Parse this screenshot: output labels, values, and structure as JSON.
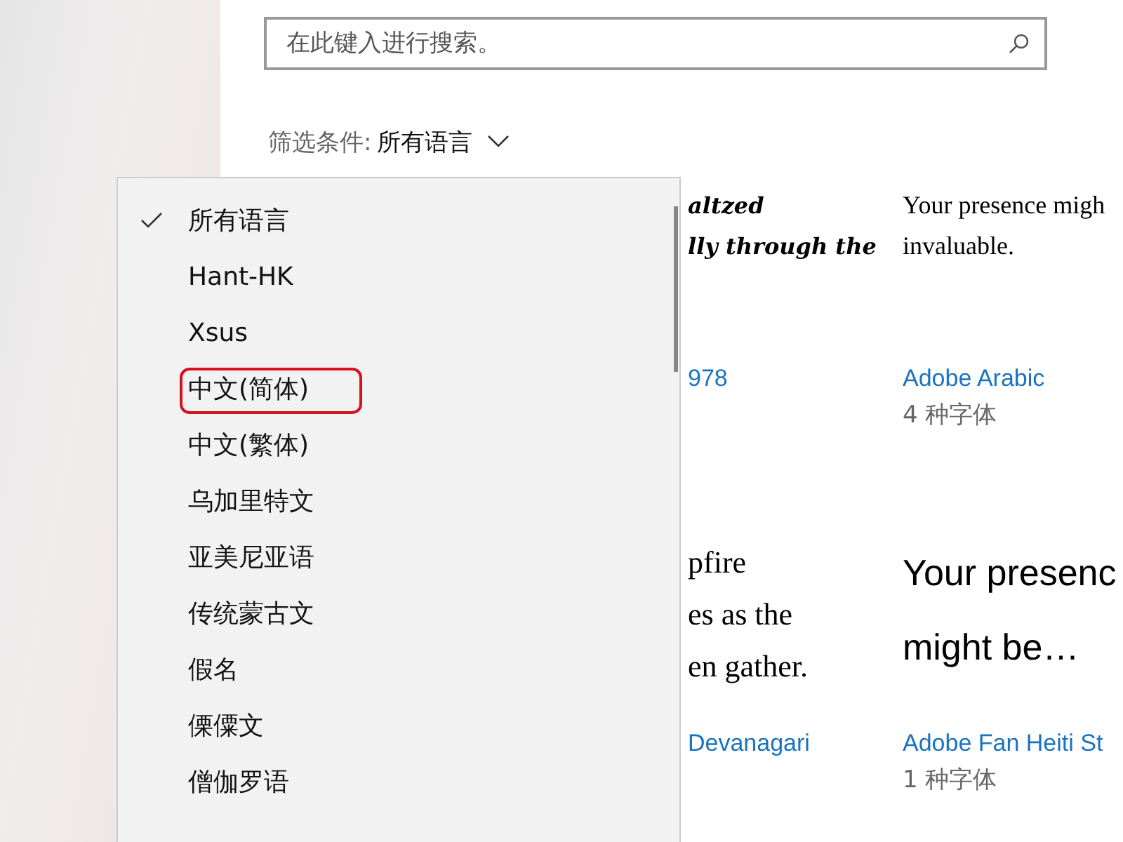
{
  "search": {
    "placeholder": "在此键入进行搜索。"
  },
  "filter": {
    "label": "筛选条件:",
    "value": "所有语言",
    "expanded": true
  },
  "language_menu": [
    {
      "label": "所有语言",
      "selected": true,
      "circled": false
    },
    {
      "label": "Hant-HK",
      "selected": false,
      "circled": false
    },
    {
      "label": "Xsus",
      "selected": false,
      "circled": false
    },
    {
      "label": "中文(简体)",
      "selected": false,
      "circled": true
    },
    {
      "label": "中文(繁体)",
      "selected": false,
      "circled": false
    },
    {
      "label": "乌加里特文",
      "selected": false,
      "circled": false
    },
    {
      "label": "亚美尼亚语",
      "selected": false,
      "circled": false
    },
    {
      "label": "传统蒙古文",
      "selected": false,
      "circled": false
    },
    {
      "label": "假名",
      "selected": false,
      "circled": false
    },
    {
      "label": "傈僳文",
      "selected": false,
      "circled": false
    },
    {
      "label": "僧伽罗语",
      "selected": false,
      "circled": false
    }
  ],
  "fonts": [
    {
      "kind": "script",
      "sample": [
        "altzed",
        "lly through the"
      ],
      "name": "978"
    },
    {
      "kind": "serif",
      "sample": [
        "Your presence migh",
        "invaluable."
      ],
      "name": "Adobe Arabic",
      "count": "4 种字体"
    },
    {
      "kind": "serif-large",
      "sample": [
        "pfire",
        "es as the",
        "en gather."
      ],
      "name": "Devanagari"
    },
    {
      "kind": "sans-large",
      "sample": [
        "Your presenc",
        "might be…"
      ],
      "name": "Adobe Fan Heiti St",
      "count": "1 种字体"
    }
  ]
}
